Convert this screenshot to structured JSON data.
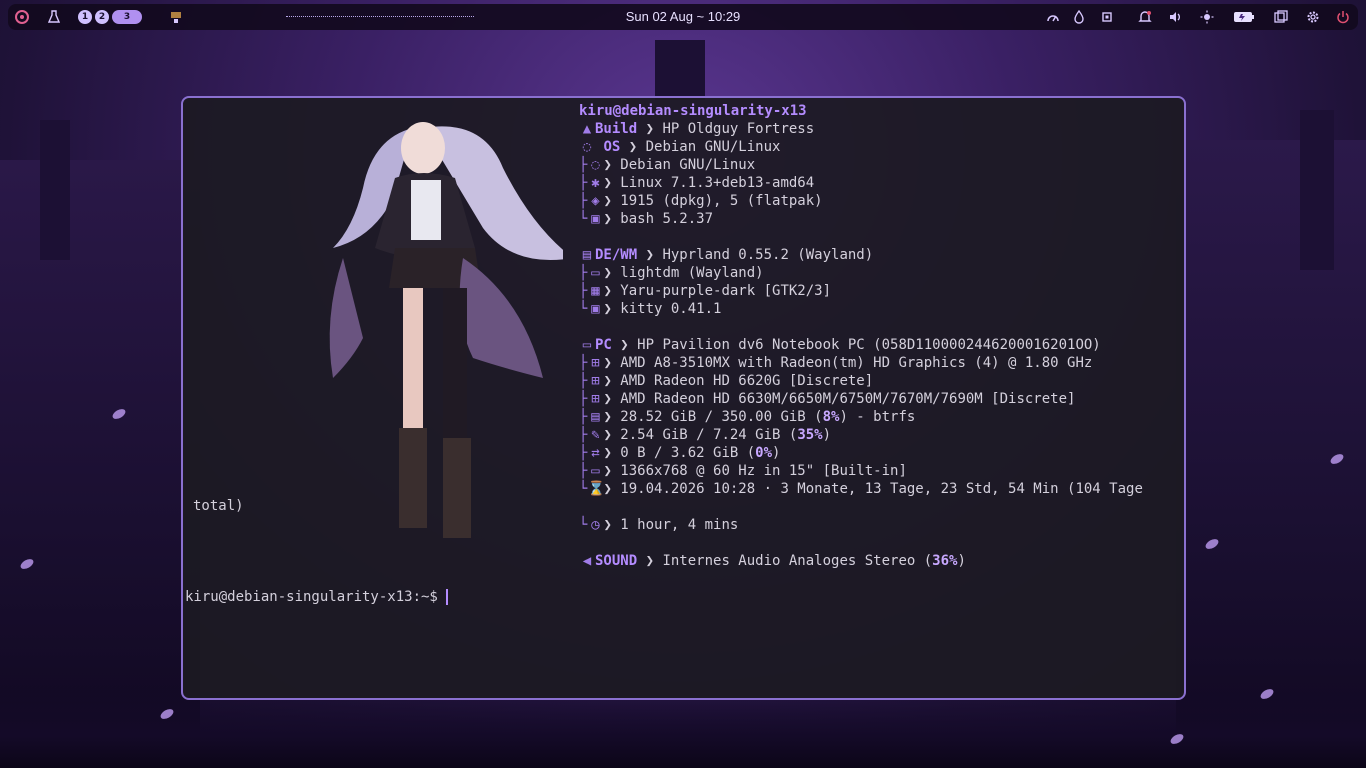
{
  "topbar": {
    "workspaces": [
      "1",
      "2",
      "3"
    ],
    "clock": "Sun 02 Aug ~ 10:29",
    "icons_left": [
      "launcher-icon",
      "flask-icon",
      "app-icon"
    ],
    "icons_right": [
      "gauge-icon",
      "temperature-icon",
      "cpu-icon",
      "bell-icon",
      "volume-icon",
      "brightness-icon",
      "battery-icon",
      "windows-icon",
      "settings-icon",
      "power-icon"
    ]
  },
  "terminal": {
    "userhost": "kiru@debian-singularity-x13",
    "lines": [
      {
        "key": "Build",
        "text": "❯ HP Oldguy Fortress"
      },
      {
        "key": "OS",
        "text": "❯ Debian GNU/Linux"
      },
      {
        "text": "❯ Debian GNU/Linux"
      },
      {
        "text": "❯ Linux 7.1.3+deb13-amd64"
      },
      {
        "text": "❯ 1915 (dpkg), 5 (flatpak)"
      },
      {
        "text": "❯ bash 5.2.37"
      },
      {
        "key": "DE/WM",
        "text": "❯ Hyprland 0.55.2 (Wayland)"
      },
      {
        "text": "❯ lightdm (Wayland)"
      },
      {
        "text": "❯ Yaru-purple-dark [GTK2/3]"
      },
      {
        "text": "❯ kitty 0.41.1"
      },
      {
        "key": "PC",
        "text": "❯ HP Pavilion dv6 Notebook PC (058D1100002446200016201OO)"
      },
      {
        "text": "❯ AMD A8-3510MX with Radeon(tm) HD Graphics (4) @ 1.80 GHz"
      },
      {
        "text": "❯ AMD Radeon HD 6620G [Discrete]"
      },
      {
        "text": "❯ AMD Radeon HD 6630M/6650M/6750M/7670M/7690M [Discrete]"
      },
      {
        "text_pre": "❯ 28.52 GiB / 350.00 GiB (",
        "pct": "8%",
        "text_post": ") - btrfs"
      },
      {
        "text_pre": "❯ 2.54 GiB / 7.24 GiB (",
        "pct": "35%",
        "text_post": ")"
      },
      {
        "text_pre": "❯ 0 B / 3.62 GiB (",
        "pct": "0%",
        "text_post": ")"
      },
      {
        "text": "❯ 1366x768 @ 60 Hz in 15\" [Built-in]"
      },
      {
        "text": "❯ 19.04.2026 10:28 · 3 Monate, 13 Tage, 23 Std, 54 Min (104 Tage"
      },
      {
        "text": "❯ 1 hour, 4 mins"
      },
      {
        "key": "SOUND",
        "text_pre": "❯ Internes Audio Analoges Stereo (",
        "pct": "36%",
        "text_post": ")"
      }
    ],
    "wrap_total": "total)",
    "prompt": "kiru@debian-singularity-x13:~$ "
  },
  "colors": {
    "accent": "#b48cff",
    "border": "#8a70d0",
    "bg": "#1c1a22"
  }
}
